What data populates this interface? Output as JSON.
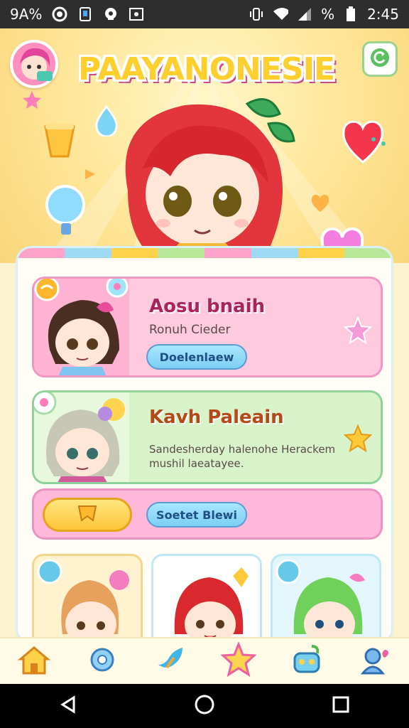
{
  "status_bar": {
    "left_text": "9A%",
    "battery_percent": "%",
    "time": "2:45",
    "left_icons": [
      "record-icon",
      "sim-icon",
      "notification-icon",
      "image-icon"
    ],
    "right_icons": [
      "vibrate-icon",
      "wifi-icon",
      "signal-icon",
      "battery-icon"
    ]
  },
  "header": {
    "title": "PAAYANONESIE",
    "title_color": "#ffcf2e",
    "menu_icon": "refresh-icon"
  },
  "cards": [
    {
      "name": "Aosu bnaih",
      "subtitle": "Ronuh Cieder",
      "button": "Doelenlaew",
      "bg": "#ffc9de",
      "border": "#f197c2"
    },
    {
      "name": "Kavh Paleain",
      "subtitle": "Sandesherday halenohe Herackem mushil laeatayee.",
      "bg": "#d8f3c9",
      "border": "#8fd29b"
    }
  ],
  "action_row": {
    "button": "Soetet Blewi",
    "bg": "#ffb8da",
    "border": "#ee93c1"
  },
  "bottom_nav": [
    {
      "icon": "home-icon",
      "color": "#f3a634"
    },
    {
      "icon": "gear-icon",
      "color": "#6fb9e6"
    },
    {
      "icon": "leaf-icon",
      "color": "#56b9e3"
    },
    {
      "icon": "star-icon",
      "color": "#ffd34d"
    },
    {
      "icon": "robot-icon",
      "color": "#77d0f0"
    },
    {
      "icon": "profile-icon",
      "color": "#79b8ef"
    }
  ],
  "android_nav": [
    "back-icon",
    "home-circle-icon",
    "recents-icon"
  ],
  "colors": {
    "accent_pink": "#f58fc0",
    "accent_blue": "#7ccff4",
    "accent_yellow": "#ffd24a"
  }
}
